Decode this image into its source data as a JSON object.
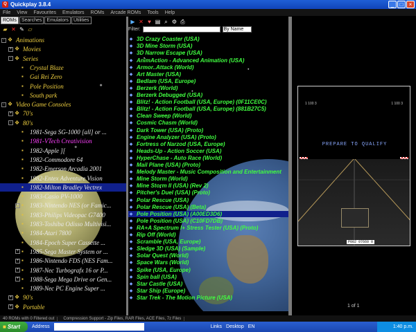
{
  "window": {
    "title": "Quickplay 3.8.4"
  },
  "menu": [
    "File",
    "View",
    "Favourites",
    "Emulators",
    "ROMs",
    "Arcade ROMs",
    "Tools",
    "Help"
  ],
  "left_tabs": [
    "ROMs",
    "Searches",
    "Emulators",
    "Utilities"
  ],
  "tree": [
    {
      "label": "Animations",
      "level": 0,
      "expand": "-"
    },
    {
      "label": "Movies",
      "level": 1,
      "expand": "+"
    },
    {
      "label": "Series",
      "level": 1,
      "expand": "-"
    },
    {
      "label": "Crystal Blaze",
      "level": 2,
      "expand": ""
    },
    {
      "label": "Gai Rei Zero",
      "level": 2,
      "expand": ""
    },
    {
      "label": "Pole Position",
      "level": 2,
      "expand": ""
    },
    {
      "label": "South park",
      "level": 2,
      "expand": ""
    },
    {
      "label": "Video Game Consoles",
      "level": 0,
      "expand": "-"
    },
    {
      "label": "70's",
      "level": 1,
      "expand": "+"
    },
    {
      "label": "80's",
      "level": 1,
      "expand": "-"
    },
    {
      "label": "1981-Sega SG-1000 [all] or ...",
      "level": 2,
      "expand": "",
      "white": true
    },
    {
      "label": "1981-VTech Creativision",
      "level": 2,
      "expand": "",
      "pink": true
    },
    {
      "label": "1982-Apple ][",
      "level": 2,
      "expand": "",
      "white": true
    },
    {
      "label": "1982-Commodore 64",
      "level": 2,
      "expand": "",
      "white": true
    },
    {
      "label": "1982-Emerson Arcadia 2001",
      "level": 2,
      "expand": "",
      "white": true
    },
    {
      "label": "1982-Entex Adventure Vision",
      "level": 2,
      "expand": "",
      "white": true
    },
    {
      "label": "1982-Milton Bradley Vectrex",
      "level": 2,
      "expand": "",
      "white": true,
      "selected": true
    },
    {
      "label": "1983-Casio PV-1000",
      "level": 2,
      "expand": "",
      "white": true
    },
    {
      "label": "1983-Nintendo NES (or Famic...",
      "level": 2,
      "expand": "+",
      "white": true
    },
    {
      "label": "1983-Philips Videopac G7400",
      "level": 2,
      "expand": "",
      "white": true
    },
    {
      "label": "1983-Toshiba Odisso Multivisi...",
      "level": 2,
      "expand": "",
      "white": true
    },
    {
      "label": "1984-Atari 7800",
      "level": 2,
      "expand": "",
      "white": true
    },
    {
      "label": "1984-Epoch Super Cassette ...",
      "level": 2,
      "expand": "",
      "white": true
    },
    {
      "label": "1985-Sega Master System or ...",
      "level": 2,
      "expand": "+",
      "white": true
    },
    {
      "label": "1986-Nintendo FDS (NES Fam...",
      "level": 2,
      "expand": "+",
      "white": true
    },
    {
      "label": "1987-Nec Turbografx 16 or P...",
      "level": 2,
      "expand": "+",
      "white": true
    },
    {
      "label": "1988-Sega Mega Drive or Gen...",
      "level": 2,
      "expand": "+",
      "white": true
    },
    {
      "label": "1989-Nec PC Engine Super ...",
      "level": 2,
      "expand": "",
      "white": true
    },
    {
      "label": "90's",
      "level": 1,
      "expand": "+"
    },
    {
      "label": "Portable",
      "level": 1,
      "expand": "+"
    }
  ],
  "filter": {
    "label": "Filter:",
    "value": "",
    "sort": "By Name"
  },
  "roms": [
    "3D Crazy Coaster (USA)",
    "3D Mine Storm (USA)",
    "3D Narrow Escape (USA)",
    "AnimAction - Advanced Animation (USA)",
    "Armor..Attack (World)",
    "Art Master (USA)",
    "Bedlam (USA, Europe)",
    "Berzerk (World)",
    "Berzerk Debugged (USA)",
    "Blitz! - Action Football (USA, Europe) (0F11CE0C)",
    "Blitz! - Action Football (USA, Europe) (881B27C5)",
    "Clean Sweep (World)",
    "Cosmic Chasm (World)",
    "Dark Tower (USA) (Proto)",
    "Engine Analyzer (USA) (Proto)",
    "Fortress of Narzod (USA, Europe)",
    "Heads-Up - Action Soccer (USA)",
    "HyperChase - Auto Race (World)",
    "Mail Plane (USA) (Proto)",
    "Melody Master - Music Composition and Entertainment",
    "Mine Storm (World)",
    "Mine Storm II (USA) (Rev 2)",
    "Pitcher's Duel (USA) (Proto)",
    "Polar Rescue (USA)",
    "Polar Rescue (USA) (Beta)",
    "Pole Position (USA) (A00ED3D6)",
    "Pole Position (USA) (C10FD7DB)",
    "RA+A Spectrum I+ Stress Tester (USA) (Proto)",
    "Rip Off (World)",
    "Scramble (USA, Europe)",
    "Sledge 3D (USA) (Sample)",
    "Solar Quest (World)",
    "Space Wars (World)",
    "Spike (USA, Europe)",
    "Spin ball (USA)",
    "Star Castle (USA)",
    "Star Ship (Europe)",
    "Star Trek - The Motion Picture (USA)"
  ],
  "selected_rom_index": 25,
  "preview": {
    "message": "PREPARE TO QUALIFY",
    "hud_left": "1      100      3",
    "hud_right": "1      100      3",
    "speed": "P002 07660 0",
    "pager": "1 of 1"
  },
  "status": [
    "40 ROMs with 0 Filtered out",
    "Compression Support - Zip Files, RAR Files, ACE Files, 7z Files"
  ],
  "taskbar": {
    "start": "Start",
    "address": "Address",
    "links": "Links",
    "desktop": "Desktop",
    "lang": "EN",
    "time": "1:40 p.m."
  }
}
